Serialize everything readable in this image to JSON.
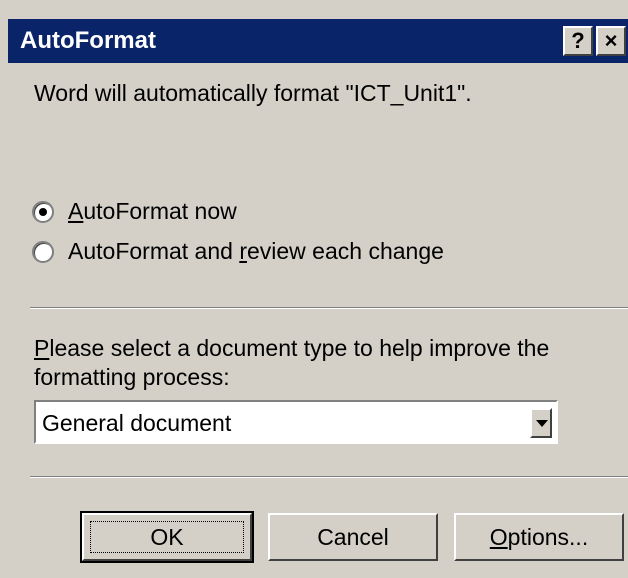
{
  "window": {
    "title": "AutoFormat",
    "help_button": "?",
    "close_button": "×"
  },
  "message": "Word will automatically format \"ICT_Unit1\".",
  "options": {
    "now": {
      "label_u": "A",
      "label_rest": "utoFormat now",
      "checked": true
    },
    "review": {
      "label_pre": "AutoFormat and ",
      "label_u": "r",
      "label_rest": "eview each change",
      "checked": false
    }
  },
  "doc_type": {
    "prompt_u": "P",
    "prompt_rest": "lease select a document type to help improve the formatting process:",
    "selected": "General document"
  },
  "buttons": {
    "ok": "OK",
    "cancel": "Cancel",
    "options_u": "O",
    "options_rest": "ptions..."
  }
}
